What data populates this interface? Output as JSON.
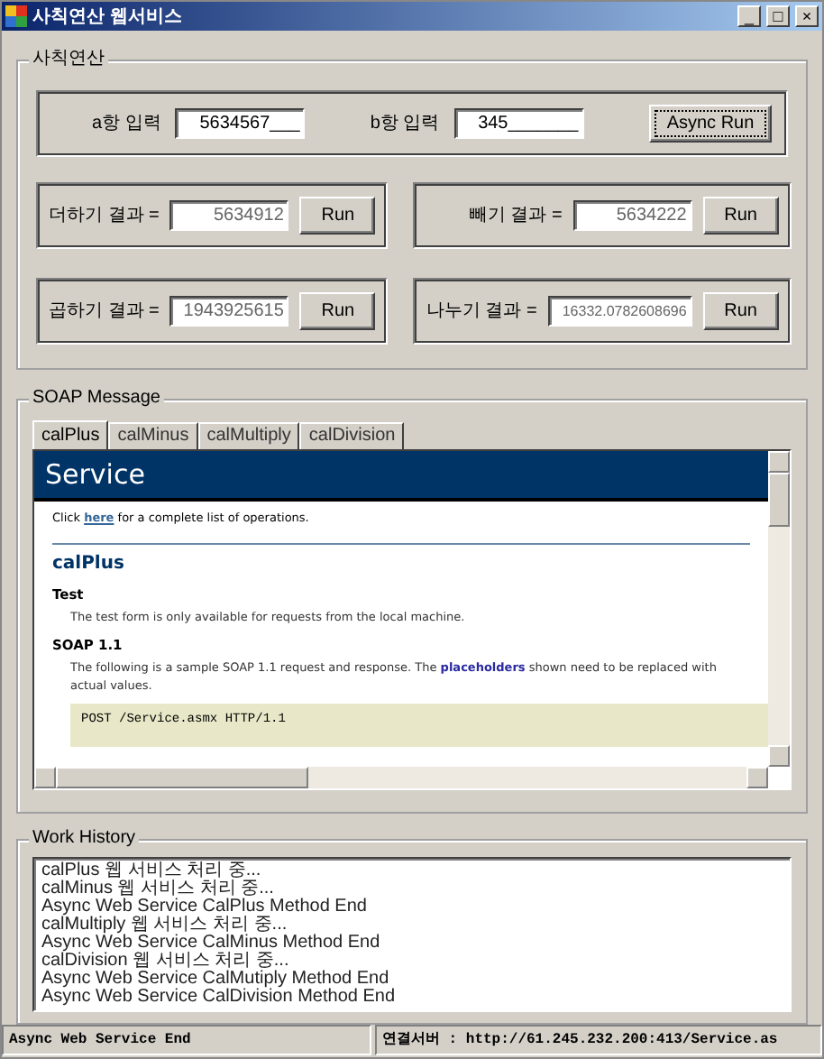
{
  "window": {
    "title": "사칙연산 웹서비스",
    "controls": [
      "_",
      "□",
      "×"
    ]
  },
  "calc": {
    "title": "사칙연산",
    "inputs": [
      {
        "label": "a항 입력",
        "value": "5634567___"
      },
      {
        "label": "b항 입력",
        "value": "345_______"
      }
    ],
    "async_button": "Async Run",
    "results": [
      {
        "label": "더하기 결과  =",
        "value": "5634912",
        "button": "Run"
      },
      {
        "label": "빼기 결과  =",
        "value": "5634222",
        "button": "Run"
      },
      {
        "label": "곱하기 결과  =",
        "value": "1943925615",
        "button": "Run"
      },
      {
        "label": "나누기 결과  =",
        "value": "16332.0782608696",
        "button": "Run"
      }
    ]
  },
  "soap": {
    "title": "SOAP Message",
    "tabs": [
      {
        "label": "calPlus",
        "selected": true
      },
      {
        "label": "calMinus",
        "selected": false
      },
      {
        "label": "calMultiply",
        "selected": false
      },
      {
        "label": "calDivision",
        "selected": false
      }
    ],
    "page": {
      "header": "Service",
      "intro": [
        "Click",
        "here",
        "for a complete list of operations."
      ],
      "operation": "calPlus",
      "sections": [
        {
          "heading": "Test",
          "text": "The test form is only available for requests from the local machine."
        },
        {
          "heading": "SOAP 1.1",
          "text": "The following is a sample SOAP 1.1 request and response. The **placeholders** shown need to be replaced with actual values."
        }
      ],
      "code": "POST /Service.asmx HTTP/1.1"
    }
  },
  "history": {
    "title": "Work History",
    "lines": [
      "calPlus 웹 서비스 처리 중...",
      "calMinus 웹 서비스 처리 중...",
      "Async Web Service CalPlus Method End",
      "calMultiply 웹 서비스 처리 중...",
      "Async Web Service CalMinus Method End",
      "calDivision 웹 서비스 처리 중...",
      "Async Web Service CalMutiply Method End",
      "Async Web Service CalDivision Method End"
    ]
  },
  "status_bar": [
    "Async Web Service End",
    "연결서버 : http://61.245.232.200:413/Service.as"
  ]
}
